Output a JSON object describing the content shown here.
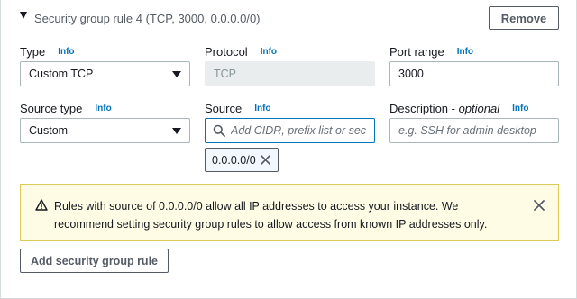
{
  "rule": {
    "title": "Security group rule 4 (TCP, 3000, 0.0.0.0/0)",
    "remove_label": "Remove"
  },
  "fields": {
    "type": {
      "label": "Type",
      "info": "Info",
      "value": "Custom TCP"
    },
    "protocol": {
      "label": "Protocol",
      "info": "Info",
      "value": "TCP"
    },
    "port_range": {
      "label": "Port range",
      "info": "Info",
      "value": "3000"
    },
    "source_type": {
      "label": "Source type",
      "info": "Info",
      "value": "Custom"
    },
    "source": {
      "label": "Source",
      "info": "Info",
      "placeholder": "Add CIDR, prefix list or security"
    },
    "description": {
      "label": "Description - ",
      "label_italic": "optional",
      "info": "Info",
      "placeholder": "e.g. SSH for admin desktop"
    }
  },
  "source_tokens": [
    "0.0.0.0/0"
  ],
  "alert": {
    "text": "Rules with source of 0.0.0.0/0 allow all IP addresses to access your instance. We recommend setting security group rules to allow access from known IP addresses only."
  },
  "add_button_label": "Add security group rule",
  "colors": {
    "link": "#0073bb",
    "focus": "#0073bb",
    "warning_bg": "#fffce6",
    "warning_border": "#e0ca57"
  }
}
